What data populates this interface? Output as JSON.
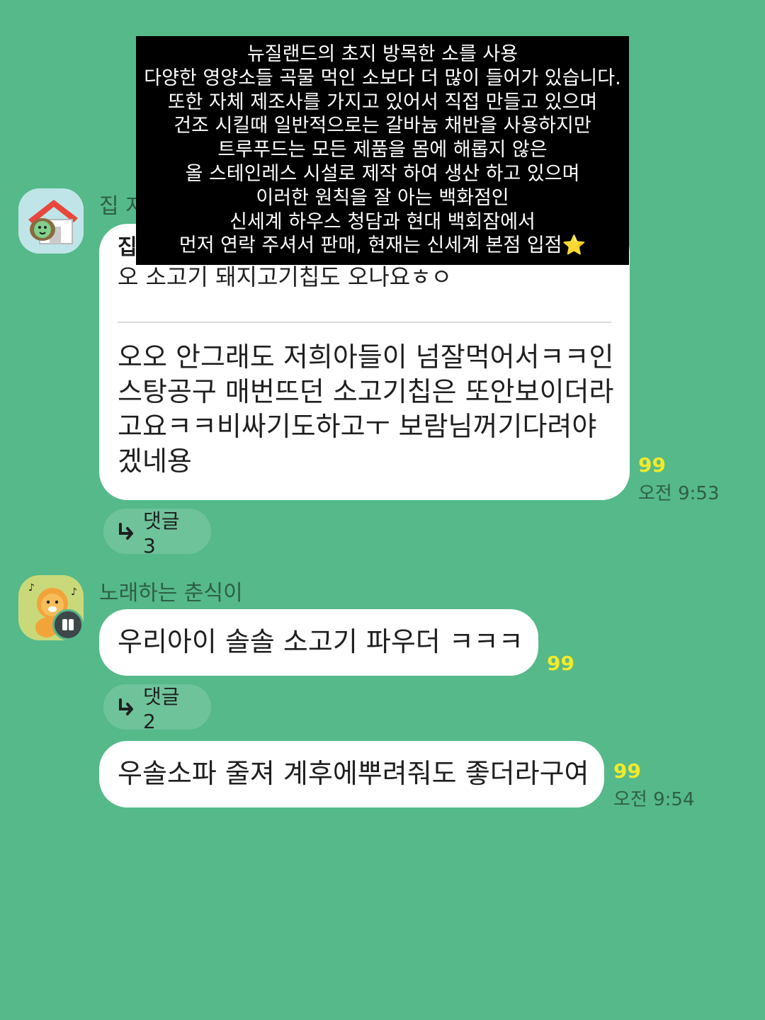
{
  "messages": [
    {
      "sender": "집 지",
      "quote": {
        "sender": "집",
        "text": "오 소고기 돼지고기칩도 오나요ㅎㅇ"
      },
      "lines": [
        "오오 안그래도 저희아들이 넘잘먹어서ㅋㅋ인",
        "스탕공구 매번뜨던 소고기칩은 또안보이더라",
        "고요ㅋㅋ비싸기도하고ㅜ 보람님꺼기다려야",
        "겠네용"
      ],
      "unread": "99",
      "time": "오전 9:53",
      "replies": "댓글 3"
    },
    {
      "sender": "노래하는 춘식이",
      "text": "우리아이 솔솔 소고기 파우더 ㅋㅋㅋ",
      "unread": "99",
      "replies": "댓글 2"
    },
    {
      "text": "우솔소파 줄져 계후에뿌려줘도 좋더라구여",
      "unread": "99",
      "time": "오전 9:54"
    }
  ],
  "overlay": {
    "lines": [
      "뉴질랜드의 초지 방목한 소를 사용",
      "다양한 영양소들 곡물 먹인 소보다 더 많이 들어가 있습니다.",
      "또한  자체 제조사를 가지고 있어서 직접 만들고 있으며",
      "건조 시킬때 일반적으로는 갈바늄 채반을 사용하지만",
      "트루푸드는 모든 제품을 몸에 해롭지 않은",
      "올 스테인레스 시설로 제작 하여 생산 하고 있으며",
      "이러한 원칙을 잘 아는 백화점인",
      "신세계 하우스 청담과 현대 백회잠에서",
      "먼저 연락 주셔서 판매, 현재는 신세계 본점 입점"
    ],
    "emoji": "⭐"
  },
  "icons": {
    "avatar1": "house-character-avatar",
    "avatar2": "singing-lion-avatar",
    "reply": "reply-arrow-icon",
    "badge": "pause-badge-icon"
  },
  "colors": {
    "background": "#55b98a",
    "bubble": "#ffffff",
    "unread": "#f3ea2a",
    "reply_pill": "#6ec39b",
    "overlay": "#000000"
  }
}
